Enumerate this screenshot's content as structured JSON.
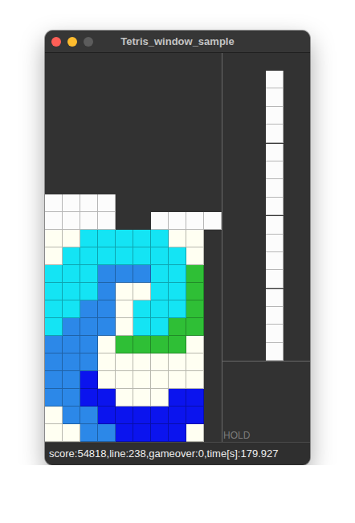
{
  "window": {
    "title": "Tetris_window_sample",
    "buttons": [
      {
        "color": "#ff5f57"
      },
      {
        "color": "#febc2e"
      },
      {
        "color": "#5c5c5c"
      }
    ]
  },
  "palette": {
    "W": "#fcfcfc",
    "Y": "#fffff2",
    "C": "#14e4f4",
    "L": "#2c88e8",
    "B": "#0b14ee",
    "G": "#2fbf36"
  },
  "board": {
    "rows": [
      "..........",
      "..........",
      "..........",
      "..........",
      "..........",
      "..........",
      "..........",
      "..........",
      "WWWW......",
      "WWWW..WWWW",
      "YYCCCCCYY.",
      "YCCCCCCCY.",
      "CCCLLLCCG.",
      "CCCLYYCCG.",
      "CCLLYCCCG.",
      "CLLLYCCGG.",
      "LLLYGGGGY.",
      "LLLYYYYYY.",
      "LLBYYYYYY.",
      "LLBBYYYBB.",
      "YLLBBBBBB.",
      "YYLLBBBBY."
    ]
  },
  "next": [
    {
      "color": "#fcfcfc",
      "rows": [
        "X",
        "X",
        "X",
        "X"
      ]
    },
    {
      "color": "#fcfcfc",
      "rows": [
        "X",
        "X",
        "X",
        "X"
      ]
    },
    {
      "color": "#fcfcfc",
      "rows": [
        "X",
        "X",
        "X",
        "X"
      ]
    },
    {
      "color": "#fcfcfc",
      "rows": [
        "X",
        "X",
        "X",
        "X"
      ]
    }
  ],
  "hold": {
    "label": "HOLD"
  },
  "status_bar": "score:54818,line:238,gameover:0,time[s]:179.927"
}
